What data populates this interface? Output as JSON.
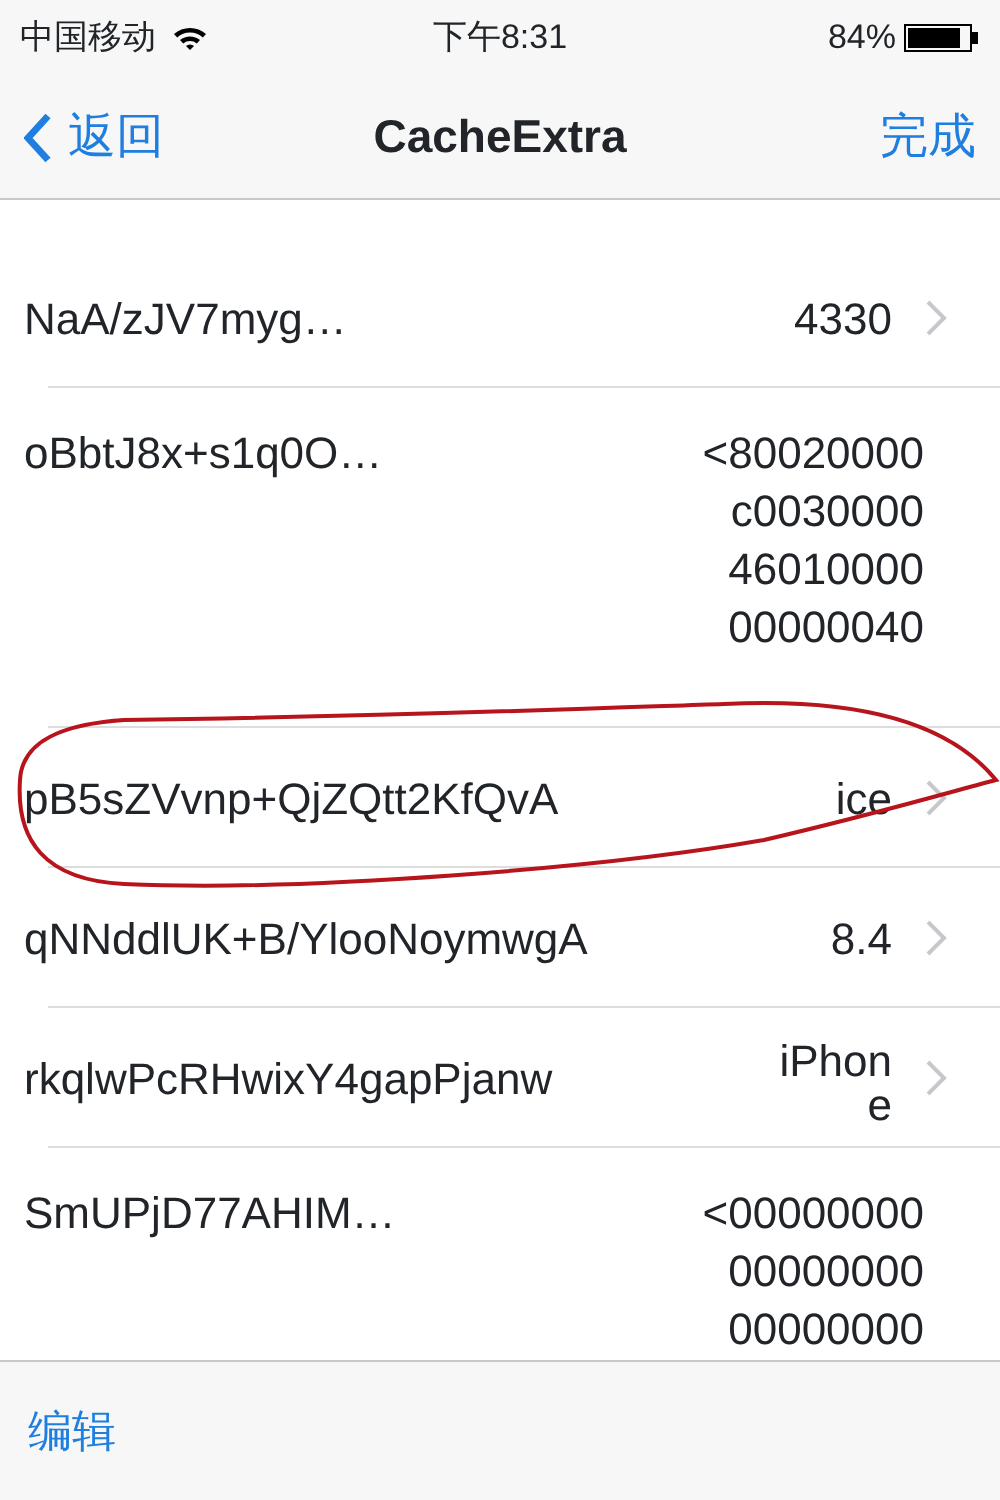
{
  "status_bar": {
    "carrier": "中国移动",
    "time": "下午8:31",
    "battery": "84%"
  },
  "nav_bar": {
    "back": "返回",
    "title": "CacheExtra",
    "done": "完成"
  },
  "rows": [
    {
      "key": "NaA/zJV7myg…",
      "value_lines": [
        "4330"
      ],
      "disclosure": true,
      "circled": false
    },
    {
      "key": "oBbtJ8x+s1q0O…",
      "value_lines": [
        "<80020000",
        "c0030000",
        "46010000",
        "00000040"
      ],
      "disclosure": false,
      "circled": false
    },
    {
      "key": "pB5sZVvnp+QjZQtt2KfQvA",
      "value_lines": [
        "ice"
      ],
      "disclosure": true,
      "circled": true
    },
    {
      "key": "qNNddlUK+B/YlooNoymwgA",
      "value_lines": [
        "8.4"
      ],
      "disclosure": true,
      "circled": false
    },
    {
      "key": "rkqlwPcRHwixY4gapPjanw",
      "value_lines": [
        "iPhon",
        "e"
      ],
      "disclosure": true,
      "circled": false
    },
    {
      "key": "SmUPjD77AHIM…",
      "value_lines": [
        "<00000000",
        "00000000",
        "00000000"
      ],
      "disclosure": false,
      "circled": false
    }
  ],
  "toolbar": {
    "edit": "编辑"
  }
}
